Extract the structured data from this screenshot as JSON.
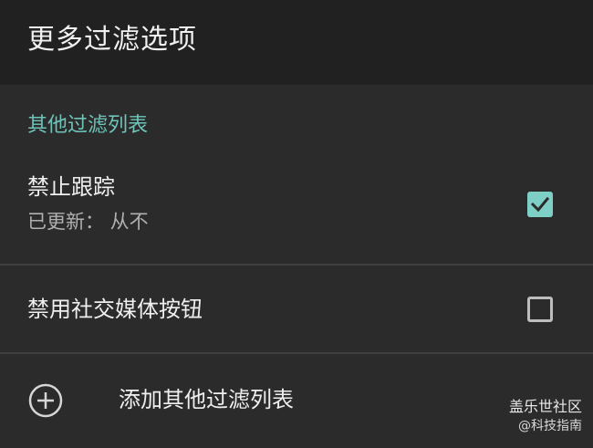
{
  "appbar": {
    "title": "更多过滤选项"
  },
  "section": {
    "header": "其他过滤列表"
  },
  "items": [
    {
      "title": "禁止跟踪",
      "subtitle": "已更新： 从不",
      "checked": true
    },
    {
      "title": "禁用社交媒体按钮",
      "checked": false
    }
  ],
  "add_action": {
    "label": "添加其他过滤列表",
    "icon": "add-circle-icon"
  },
  "watermark": {
    "title": "盖乐世社区",
    "subtitle": "@科技指南"
  },
  "colors": {
    "accent": "#6fc4ba",
    "checkbox_checked": "#7ecfc6",
    "background": "#2b2b2b",
    "appbar": "#212121"
  }
}
